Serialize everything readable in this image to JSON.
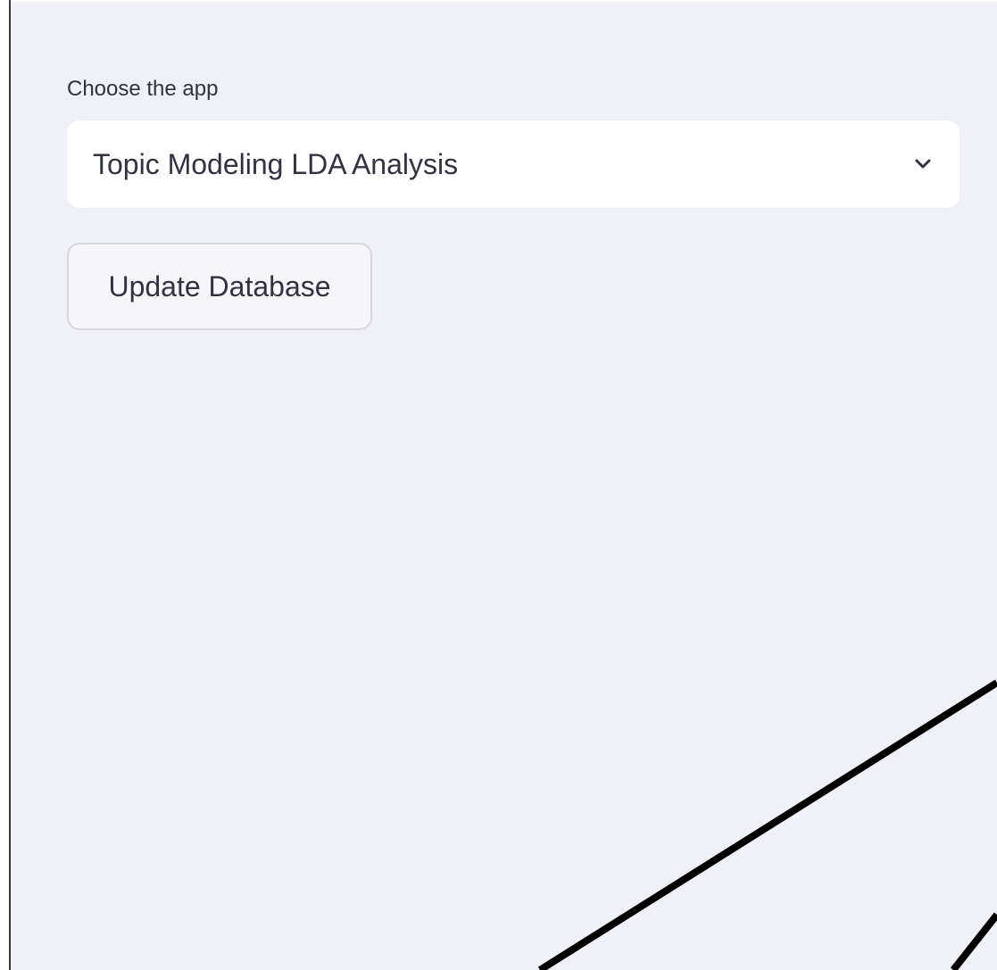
{
  "sidebar": {
    "select": {
      "label": "Choose the app",
      "value": "Topic Modeling LDA Analysis",
      "icon": "chevron-down-icon"
    },
    "update_button": {
      "label": "Update Database"
    }
  },
  "colors": {
    "background": "#f0f1f6",
    "surface": "#ffffff",
    "text": "#31333f",
    "button_border": "#d6d6dc",
    "annotation_line": "#000000"
  }
}
